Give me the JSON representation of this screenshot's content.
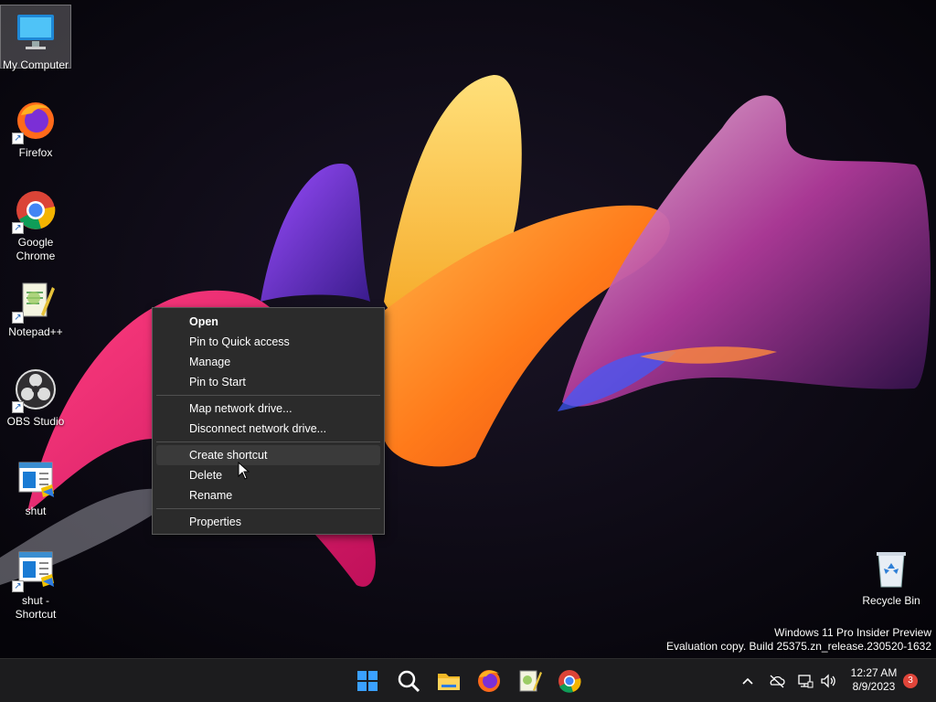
{
  "desktop": {
    "icons": [
      {
        "label": "My Computer",
        "icon": "monitor-icon",
        "selected": true
      },
      {
        "label": "Firefox",
        "icon": "firefox-icon"
      },
      {
        "label": "Google Chrome",
        "icon": "chrome-icon"
      },
      {
        "label": "Notepad++",
        "icon": "notepadpp-icon"
      },
      {
        "label": "OBS Studio",
        "icon": "obs-icon"
      },
      {
        "label": "shut",
        "icon": "script-icon"
      },
      {
        "label": "shut - Shortcut",
        "icon": "script-shortcut-icon"
      },
      {
        "label": "Recycle Bin",
        "icon": "recycle-bin-icon"
      }
    ]
  },
  "context_menu": {
    "items": [
      {
        "label": "Open",
        "default": true
      },
      {
        "label": "Pin to Quick access"
      },
      {
        "label": "Manage"
      },
      {
        "label": "Pin to Start"
      },
      {
        "label": "Map network drive..."
      },
      {
        "label": "Disconnect network drive..."
      },
      {
        "label": "Create shortcut",
        "highlighted": true
      },
      {
        "label": "Delete"
      },
      {
        "label": "Rename"
      },
      {
        "label": "Properties"
      }
    ]
  },
  "watermark": {
    "line1": "Windows 11 Pro Insider Preview",
    "line2": "Evaluation copy. Build 25375.zn_release.230520-1632"
  },
  "taskbar": {
    "apps": [
      "start-icon",
      "search-icon",
      "file-explorer-icon",
      "firefox-icon",
      "notepadpp-icon",
      "chrome-icon"
    ],
    "tray": {
      "icons": [
        "chevron-up-icon",
        "onedrive-offline-icon",
        "network-icon",
        "volume-icon"
      ],
      "time": "12:27 AM",
      "date": "8/9/2023",
      "notification_count": "3"
    }
  },
  "colors": {
    "taskbar": "#1c1c1e",
    "menu_bg": "#2b2b2b",
    "badge": "#e0453a",
    "accent": "#0078d4"
  }
}
